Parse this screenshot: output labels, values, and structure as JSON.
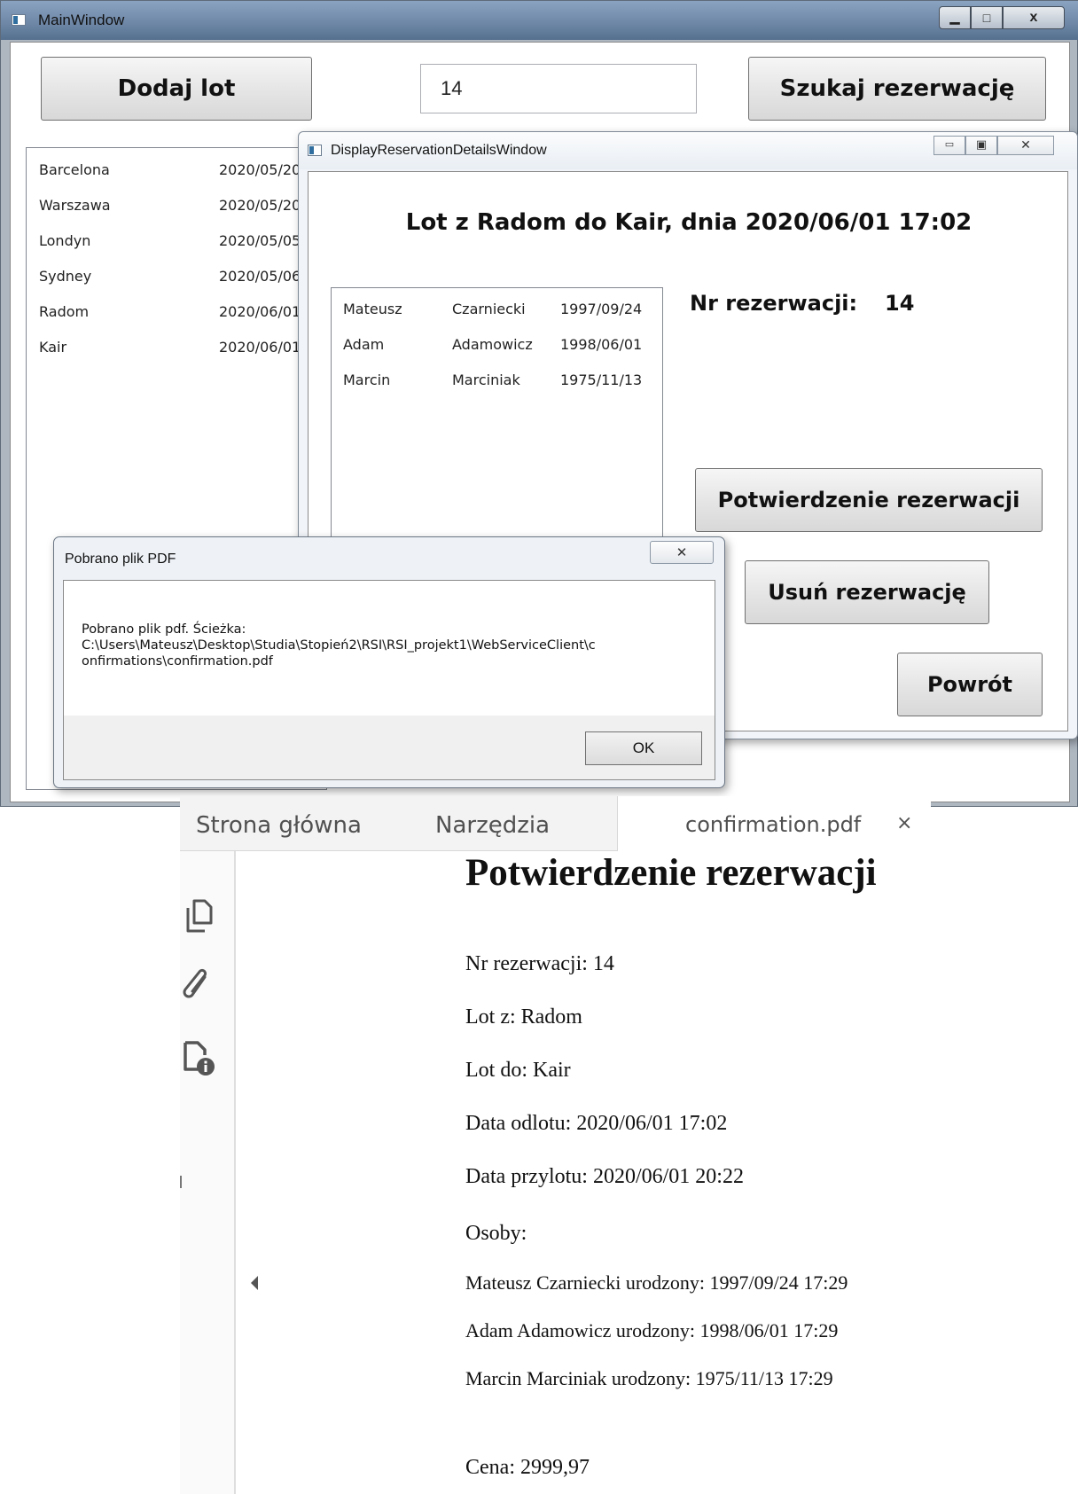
{
  "main_window": {
    "title": "MainWindow",
    "add_flight_button": "Dodaj lot",
    "search_input_value": "14",
    "search_button": "Szukaj rezerwację",
    "flights": [
      {
        "city": "Barcelona",
        "date": "2020/05/20"
      },
      {
        "city": "Warszawa",
        "date": "2020/05/20"
      },
      {
        "city": "Londyn",
        "date": "2020/05/05"
      },
      {
        "city": "Sydney",
        "date": "2020/05/06"
      },
      {
        "city": "Radom",
        "date": "2020/06/01"
      },
      {
        "city": "Kair",
        "date": "2020/06/01"
      }
    ]
  },
  "details_window": {
    "title": "DisplayReservationDetailsWindow",
    "heading": "Lot z Radom do Kair, dnia 2020/06/01 17:02",
    "passengers": [
      {
        "first": "Mateusz",
        "last": "Czarniecki",
        "born": "1997/09/24"
      },
      {
        "first": "Adam",
        "last": "Adamowicz",
        "born": "1998/06/01"
      },
      {
        "first": "Marcin",
        "last": "Marciniak",
        "born": "1975/11/13"
      }
    ],
    "reservation_label": "Nr rezerwacji:",
    "reservation_number": "14",
    "confirm_button": "Potwierdzenie rezerwacji",
    "delete_button": "Usuń rezerwację",
    "back_button": "Powrót"
  },
  "pdf_dialog": {
    "title": "Pobrano plik PDF",
    "message_line1": "Pobrano plik pdf. Ścieżka:",
    "message_line2": "C:\\Users\\Mateusz\\Desktop\\Studia\\Stopień2\\RSI\\RSI_projekt1\\WebServiceClient\\c",
    "message_line3": "onfirmations\\confirmation.pdf",
    "ok_button": "OK"
  },
  "pdf_viewer": {
    "tabs": [
      "Strona główna",
      "Narzędzia"
    ],
    "file_tab": "confirmation.pdf",
    "close_symbol": "×",
    "rail_icons": [
      "copy-pages-icon",
      "attachment-icon",
      "file-info-icon"
    ],
    "document": {
      "title": "Potwierdzenie rezerwacji",
      "reservation": "Nr rezerwacji: 14",
      "from": "Lot z: Radom",
      "to": "Lot do: Kair",
      "departure": "Data odlotu: 2020/06/01 17:02",
      "arrival": "Data przylotu: 2020/06/01 20:22",
      "people_label": "Osoby:",
      "people": [
        "Mateusz Czarniecki urodzony: 1997/09/24 17:29",
        "Adam Adamowicz urodzony: 1998/06/01 17:29",
        "Marcin Marciniak urodzony: 1975/11/13 17:29"
      ],
      "price": "Cena: 2999,97"
    }
  }
}
